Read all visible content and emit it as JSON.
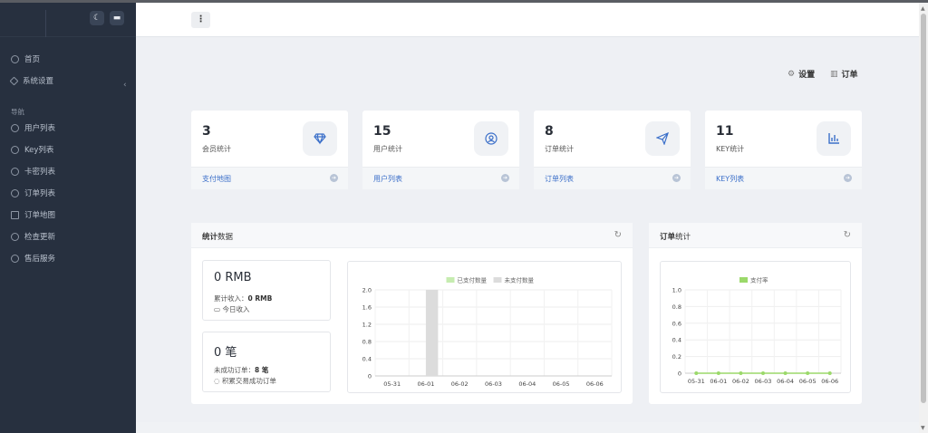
{
  "sidebar": {
    "items": [
      {
        "label": "首页",
        "icon": "clock-icon"
      },
      {
        "label": "系统设置",
        "icon": "layers-icon"
      },
      {
        "label": "用户列表",
        "icon": "users-icon"
      },
      {
        "label": "Key列表",
        "icon": "key-icon"
      },
      {
        "label": "卡密列表",
        "icon": "card-icon"
      },
      {
        "label": "订单列表",
        "icon": "heart-icon"
      },
      {
        "label": "订单地图",
        "icon": "map-icon"
      },
      {
        "label": "检查更新",
        "icon": "refresh-icon"
      },
      {
        "label": "售后服务",
        "icon": "chat-icon"
      }
    ],
    "section_label": "导航"
  },
  "header": {
    "settings_label": "设置",
    "orders_label": "订单"
  },
  "cards": [
    {
      "value": "3",
      "label": "会员统计",
      "link": "支付地图",
      "icon": "diamond-icon"
    },
    {
      "value": "15",
      "label": "用户统计",
      "link": "用户列表",
      "icon": "user-circle-icon"
    },
    {
      "value": "8",
      "label": "订单统计",
      "link": "订单列表",
      "icon": "send-icon"
    },
    {
      "value": "11",
      "label": "KEY统计",
      "link": "KEY列表",
      "icon": "chart-icon"
    }
  ],
  "stats_panel": {
    "title_bold": "统计",
    "title_rest": "数据",
    "box1": {
      "value": "0 RMB",
      "line1_label": "累计收入：",
      "line1_value": "0 RMB",
      "line2": "今日收入"
    },
    "box2": {
      "value": "0 笔",
      "line1_label": "未成功订单：",
      "line1_value": "8 笔",
      "line2": "积累交易成功订单"
    }
  },
  "orders_panel": {
    "title_bold": "订单",
    "title_rest": "统计"
  },
  "chart_data": [
    {
      "type": "bar",
      "categories": [
        "05-31",
        "06-01",
        "06-02",
        "06-03",
        "06-04",
        "06-05",
        "06-06"
      ],
      "series": [
        {
          "name": "已支付数量",
          "values": [
            0,
            0,
            0,
            0,
            0,
            0,
            0
          ],
          "color": "#c6ecb0"
        },
        {
          "name": "未支付数量",
          "values": [
            0,
            2,
            0,
            0,
            0,
            0,
            0
          ],
          "color": "#dcdcdc"
        }
      ],
      "ylim": [
        0,
        2.0
      ],
      "yticks": [
        "0",
        "0.4",
        "0.8",
        "1.2",
        "1.6",
        "2.0"
      ],
      "legend": "top-center",
      "grid": true
    },
    {
      "type": "line",
      "categories": [
        "05-31",
        "06-01",
        "06-02",
        "06-03",
        "06-04",
        "06-05",
        "06-06"
      ],
      "series": [
        {
          "name": "支付率",
          "values": [
            0,
            0,
            0,
            0,
            0,
            0,
            0
          ],
          "color": "#9bd96a"
        }
      ],
      "ylim": [
        0,
        1.0
      ],
      "yticks": [
        "0",
        "0.2",
        "0.4",
        "0.6",
        "0.8",
        "1.0"
      ],
      "legend": "top-center",
      "grid": true
    }
  ]
}
